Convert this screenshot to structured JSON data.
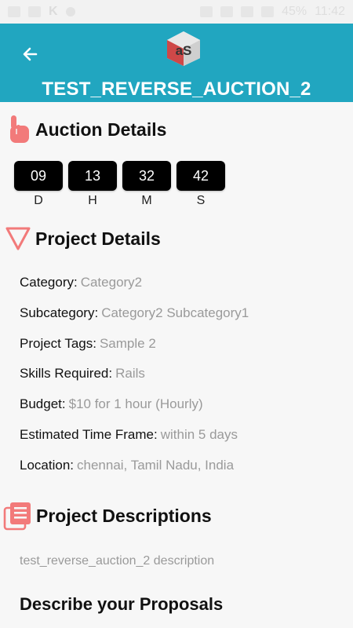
{
  "statusbar": {
    "time": "11:42",
    "battery": "45%"
  },
  "header": {
    "title": "TEST_REVERSE_AUCTION_2",
    "logo_text": "aS"
  },
  "sections": {
    "auction": "Auction Details",
    "project": "Project Details",
    "descriptions": "Project Descriptions",
    "proposals": "Describe your Proposals"
  },
  "timer": [
    {
      "value": "09",
      "label": "D"
    },
    {
      "value": "13",
      "label": "H"
    },
    {
      "value": "32",
      "label": "M"
    },
    {
      "value": "42",
      "label": "S"
    }
  ],
  "details": [
    {
      "label": "Category:",
      "value": "Category2"
    },
    {
      "label": "Subcategory:",
      "value": "Category2 Subcategory1"
    },
    {
      "label": "Project Tags:",
      "value": "Sample 2"
    },
    {
      "label": "Skills Required:",
      "value": "Rails"
    },
    {
      "label": "Budget:",
      "value": "$10 for 1 hour (Hourly)"
    },
    {
      "label": "Estimated Time Frame:",
      "value": "within 5 days"
    },
    {
      "label": "Location:",
      "value": "chennai, Tamil Nadu, India"
    }
  ],
  "description": "test_reverse_auction_2 description",
  "colors": {
    "appbar": "#21a6c0",
    "icon_accent": "#f27a7a",
    "timer_box": "#000000"
  }
}
